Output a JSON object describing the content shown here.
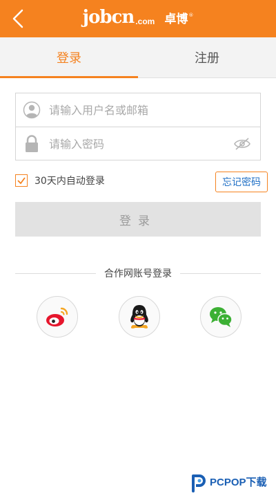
{
  "header": {
    "brand": "jobcn",
    "brand_suffix": ".com",
    "brand_cn": "卓博",
    "brand_reg": "®"
  },
  "tabs": [
    {
      "label": "登录",
      "active": true
    },
    {
      "label": "注册",
      "active": false
    }
  ],
  "form": {
    "username_placeholder": "请输入用户名或邮箱",
    "password_placeholder": "请输入密码"
  },
  "remember": {
    "label": "30天内自动登录",
    "checked": true
  },
  "forgot_label": "忘记密码",
  "login_label": "登录",
  "social": {
    "divider_label": "合作网账号登录",
    "providers": [
      "weibo-icon",
      "qq-icon",
      "wechat-icon"
    ]
  },
  "watermark": {
    "text": "PCPOP下载"
  },
  "colors": {
    "accent": "#f5821f",
    "link": "#1f6fc5",
    "button_disabled": "#e2e2e2"
  }
}
